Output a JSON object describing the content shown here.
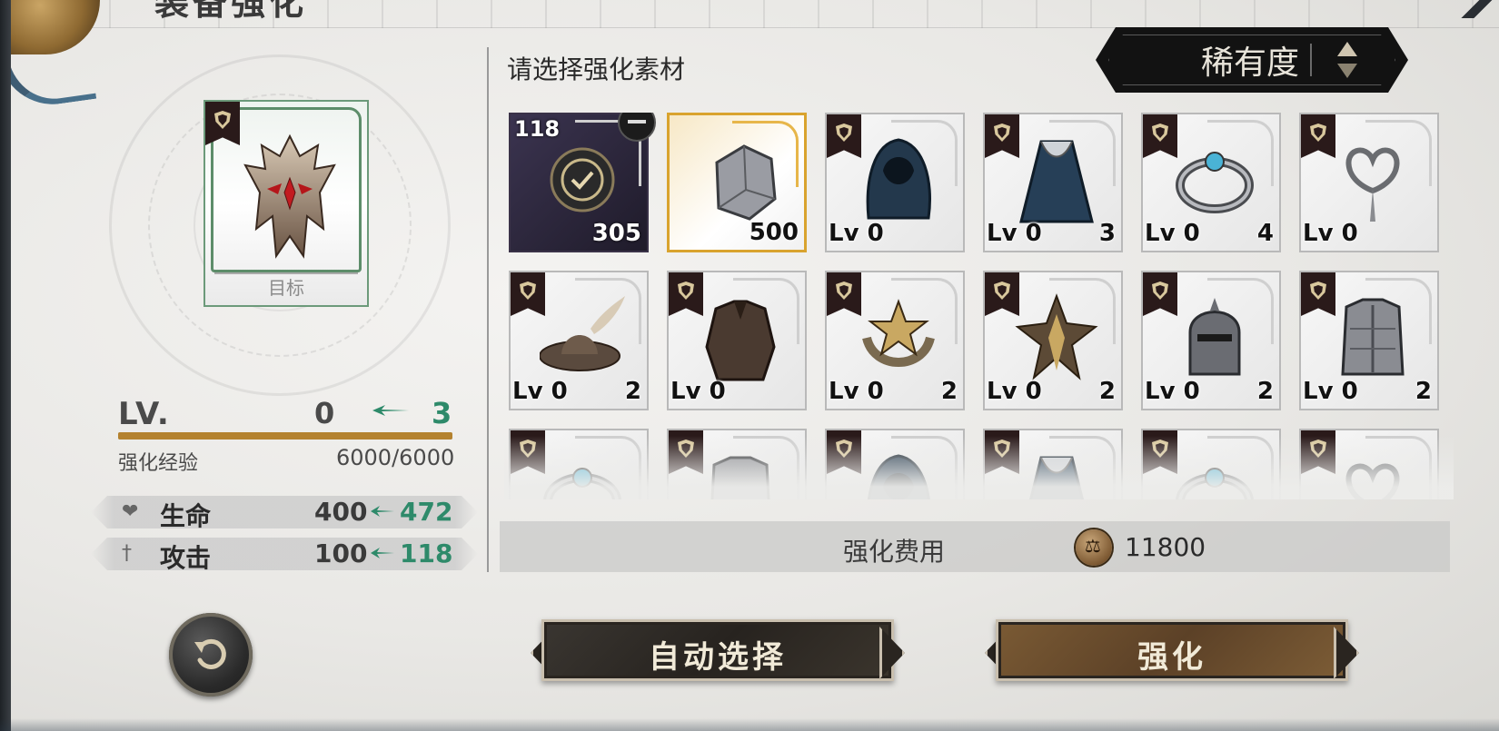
{
  "header": {
    "title": "装备强化"
  },
  "target": {
    "label": "目标"
  },
  "level": {
    "label": "LV.",
    "from": "0",
    "to": "3",
    "progress": 1.0
  },
  "exp": {
    "label": "强化经验",
    "value": "6000/6000"
  },
  "stats": [
    {
      "name": "生命",
      "from": "400",
      "to": "472",
      "icon": "heart-icon"
    },
    {
      "name": "攻击",
      "from": "100",
      "to": "118",
      "icon": "sword-icon"
    }
  ],
  "materials": {
    "prompt": "请选择强化素材",
    "sort_label": "稀有度",
    "items": [
      {
        "type": "purple",
        "top_count": "118",
        "count": "305",
        "lv": "",
        "icon": "watch-material-icon",
        "selected": true
      },
      {
        "type": "gold",
        "count": "500",
        "lv": "",
        "icon": "ore-material-icon"
      },
      {
        "type": "normal",
        "lv": "Lv 0",
        "count": "",
        "icon": "hood-icon"
      },
      {
        "type": "normal",
        "lv": "Lv 0",
        "count": "3",
        "icon": "cloak-icon"
      },
      {
        "type": "normal",
        "lv": "Lv 0",
        "count": "4",
        "icon": "ring-icon"
      },
      {
        "type": "normal",
        "lv": "Lv 0",
        "count": "",
        "icon": "heart-brooch-icon"
      },
      {
        "type": "normal",
        "lv": "Lv 0",
        "count": "2",
        "icon": "feather-hat-icon"
      },
      {
        "type": "normal",
        "lv": "Lv 0",
        "count": "",
        "icon": "leather-armor-icon"
      },
      {
        "type": "normal",
        "lv": "Lv 0",
        "count": "2",
        "icon": "star-ring-icon"
      },
      {
        "type": "normal",
        "lv": "Lv 0",
        "count": "2",
        "icon": "spiked-brooch-icon"
      },
      {
        "type": "normal",
        "lv": "Lv 0",
        "count": "2",
        "icon": "knight-helmet-icon"
      },
      {
        "type": "normal",
        "lv": "Lv 0",
        "count": "2",
        "icon": "chest-armor-icon"
      },
      {
        "type": "normal",
        "lv": "",
        "count": "",
        "icon": "ring-icon"
      },
      {
        "type": "normal",
        "lv": "",
        "count": "",
        "icon": "armor-icon"
      },
      {
        "type": "normal",
        "lv": "",
        "count": "",
        "icon": "hood-icon"
      },
      {
        "type": "normal",
        "lv": "",
        "count": "",
        "icon": "cloak-icon"
      },
      {
        "type": "normal",
        "lv": "",
        "count": "",
        "icon": "ring-icon"
      },
      {
        "type": "normal",
        "lv": "",
        "count": "",
        "icon": "heart-brooch-icon"
      }
    ]
  },
  "cost": {
    "label": "强化费用",
    "value": "11800",
    "icon": "coin-icon"
  },
  "buttons": {
    "auto_select": "自动选择",
    "enhance": "强化"
  },
  "colors": {
    "accent_green": "#2e8a6a",
    "bar_gold": "#b4822f",
    "rarity_purple": "#3b3450",
    "rarity_gold": "#d9a32e"
  }
}
